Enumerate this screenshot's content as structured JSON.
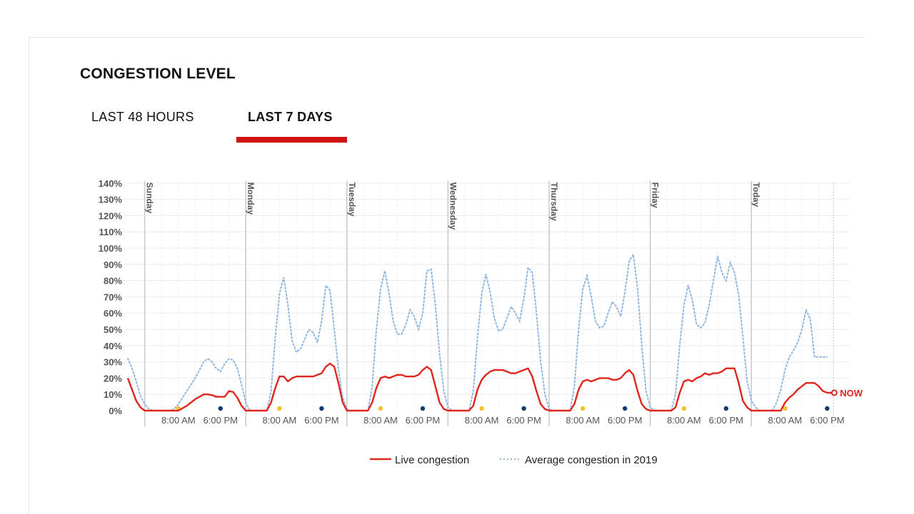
{
  "header": {
    "title": "CONGESTION LEVEL"
  },
  "tabs": [
    {
      "label": "LAST 48 HOURS",
      "active": false
    },
    {
      "label": "LAST 7 DAYS",
      "active": true
    }
  ],
  "colors": {
    "accent": "#d0120c",
    "live": "#e0261c",
    "average": "#8fb7e0",
    "grid": "#ececec",
    "day_line": "#c8c8c8",
    "morning_dot": "#f2c12e",
    "evening_dot": "#0f3c6e",
    "axis_text": "#555555"
  },
  "chart_data": {
    "type": "line",
    "y_ticks": [
      "0%",
      "10%",
      "20%",
      "30%",
      "40%",
      "50%",
      "60%",
      "70%",
      "80%",
      "90%",
      "100%",
      "110%",
      "120%",
      "130%",
      "140%"
    ],
    "ylim": [
      0,
      140
    ],
    "xlim_hours": [
      -4,
      163
    ],
    "days": [
      "Sunday",
      "Monday",
      "Tuesday",
      "Wednesday",
      "Thursday",
      "Friday",
      "Today"
    ],
    "x_tick_labels": [
      "8:00 AM",
      "6:00 PM"
    ],
    "now_label": "NOW",
    "now_hour": 163.5,
    "legend": [
      {
        "name": "Live congestion",
        "style": "solid"
      },
      {
        "name": "Average congestion in 2019",
        "style": "dotted"
      }
    ],
    "series": [
      {
        "name": "Live congestion",
        "points": [
          [
            -4,
            20
          ],
          [
            -3,
            13
          ],
          [
            -2,
            6
          ],
          [
            -1,
            2
          ],
          [
            0,
            0
          ],
          [
            5,
            0
          ],
          [
            8,
            0
          ],
          [
            10,
            3
          ],
          [
            12,
            7
          ],
          [
            14,
            10
          ],
          [
            15,
            10
          ],
          [
            16,
            9.5
          ],
          [
            17,
            8.5
          ],
          [
            19,
            8.5
          ],
          [
            20,
            12
          ],
          [
            21,
            11.5
          ],
          [
            22,
            8
          ],
          [
            23,
            3
          ],
          [
            24,
            0
          ],
          [
            29,
            0
          ],
          [
            30,
            5
          ],
          [
            31,
            14
          ],
          [
            32,
            21
          ],
          [
            33,
            21
          ],
          [
            34,
            18
          ],
          [
            35,
            20
          ],
          [
            36,
            21
          ],
          [
            40,
            21
          ],
          [
            41,
            22
          ],
          [
            42,
            23
          ],
          [
            43,
            27
          ],
          [
            44,
            29
          ],
          [
            45,
            27
          ],
          [
            46,
            17
          ],
          [
            47,
            5
          ],
          [
            48,
            0
          ],
          [
            53,
            0
          ],
          [
            54,
            5
          ],
          [
            55,
            14
          ],
          [
            56,
            20
          ],
          [
            57,
            21
          ],
          [
            58,
            20
          ],
          [
            60,
            22
          ],
          [
            61,
            22
          ],
          [
            62,
            21
          ],
          [
            64,
            21
          ],
          [
            65,
            22
          ],
          [
            66,
            25
          ],
          [
            67,
            27
          ],
          [
            68,
            25
          ],
          [
            69,
            15
          ],
          [
            70,
            5
          ],
          [
            71,
            1
          ],
          [
            72,
            0
          ],
          [
            77,
            0
          ],
          [
            78,
            3
          ],
          [
            79,
            13
          ],
          [
            80,
            19
          ],
          [
            81,
            22
          ],
          [
            82,
            24
          ],
          [
            83,
            25
          ],
          [
            85,
            25
          ],
          [
            86,
            24
          ],
          [
            87,
            23
          ],
          [
            88,
            23
          ],
          [
            89,
            24
          ],
          [
            90,
            25
          ],
          [
            91,
            26
          ],
          [
            92,
            21
          ],
          [
            93,
            12
          ],
          [
            94,
            4
          ],
          [
            95,
            1
          ],
          [
            96,
            0
          ],
          [
            101,
            0
          ],
          [
            102,
            4
          ],
          [
            103,
            13
          ],
          [
            104,
            18
          ],
          [
            105,
            19
          ],
          [
            106,
            18
          ],
          [
            107,
            19
          ],
          [
            108,
            20
          ],
          [
            110,
            20
          ],
          [
            111,
            19
          ],
          [
            112,
            19
          ],
          [
            113,
            20
          ],
          [
            114,
            23
          ],
          [
            115,
            25
          ],
          [
            116,
            22
          ],
          [
            117,
            12
          ],
          [
            118,
            4
          ],
          [
            119,
            1
          ],
          [
            120,
            0
          ],
          [
            125,
            0
          ],
          [
            126,
            2
          ],
          [
            127,
            11
          ],
          [
            128,
            18
          ],
          [
            129,
            19
          ],
          [
            130,
            18
          ],
          [
            131,
            20
          ],
          [
            132,
            21
          ],
          [
            133,
            23
          ],
          [
            134,
            22
          ],
          [
            135,
            23
          ],
          [
            136,
            23
          ],
          [
            137,
            24
          ],
          [
            138,
            26
          ],
          [
            139,
            26
          ],
          [
            140,
            26
          ],
          [
            141,
            17
          ],
          [
            142,
            6
          ],
          [
            143,
            2
          ],
          [
            144,
            0
          ],
          [
            151,
            0
          ],
          [
            152,
            5
          ],
          [
            153,
            8
          ],
          [
            154,
            10
          ],
          [
            155,
            13
          ],
          [
            156,
            15
          ],
          [
            157,
            17
          ],
          [
            159,
            17
          ],
          [
            160,
            15
          ],
          [
            161,
            12
          ],
          [
            162,
            11
          ],
          [
            163,
            11
          ]
        ]
      },
      {
        "name": "Average congestion in 2019",
        "points": [
          [
            -4,
            32
          ],
          [
            -3,
            26
          ],
          [
            -2,
            18
          ],
          [
            -1,
            9
          ],
          [
            0,
            4
          ],
          [
            1,
            1
          ],
          [
            2,
            0
          ],
          [
            6,
            0
          ],
          [
            7,
            1
          ],
          [
            8,
            4
          ],
          [
            10,
            12
          ],
          [
            12,
            20
          ],
          [
            13,
            25
          ],
          [
            14,
            30
          ],
          [
            15,
            32
          ],
          [
            16,
            30
          ],
          [
            17,
            26
          ],
          [
            18,
            24
          ],
          [
            19,
            29
          ],
          [
            20,
            32
          ],
          [
            21,
            31
          ],
          [
            22,
            26
          ],
          [
            23,
            16
          ],
          [
            24,
            5
          ],
          [
            25,
            0
          ],
          [
            29,
            0
          ],
          [
            30,
            12
          ],
          [
            31,
            45
          ],
          [
            32,
            72
          ],
          [
            33,
            82
          ],
          [
            34,
            65
          ],
          [
            35,
            43
          ],
          [
            36,
            36
          ],
          [
            37,
            38
          ],
          [
            38,
            44
          ],
          [
            39,
            50
          ],
          [
            40,
            48
          ],
          [
            41,
            42
          ],
          [
            42,
            55
          ],
          [
            43,
            77
          ],
          [
            44,
            74
          ],
          [
            45,
            50
          ],
          [
            46,
            25
          ],
          [
            47,
            8
          ],
          [
            48,
            1
          ],
          [
            49,
            0
          ],
          [
            53,
            0
          ],
          [
            54,
            15
          ],
          [
            55,
            50
          ],
          [
            56,
            75
          ],
          [
            57,
            86
          ],
          [
            58,
            72
          ],
          [
            59,
            55
          ],
          [
            60,
            47
          ],
          [
            61,
            47
          ],
          [
            62,
            53
          ],
          [
            63,
            62
          ],
          [
            64,
            58
          ],
          [
            65,
            50
          ],
          [
            66,
            60
          ],
          [
            67,
            86
          ],
          [
            68,
            87
          ],
          [
            69,
            65
          ],
          [
            70,
            35
          ],
          [
            71,
            12
          ],
          [
            72,
            2
          ],
          [
            73,
            0
          ],
          [
            77,
            0
          ],
          [
            78,
            12
          ],
          [
            79,
            45
          ],
          [
            80,
            72
          ],
          [
            81,
            84
          ],
          [
            82,
            73
          ],
          [
            83,
            57
          ],
          [
            84,
            49
          ],
          [
            85,
            50
          ],
          [
            86,
            57
          ],
          [
            87,
            64
          ],
          [
            88,
            60
          ],
          [
            89,
            55
          ],
          [
            90,
            69
          ],
          [
            91,
            88
          ],
          [
            92,
            85
          ],
          [
            93,
            60
          ],
          [
            94,
            30
          ],
          [
            95,
            10
          ],
          [
            96,
            1
          ],
          [
            97,
            0
          ],
          [
            101,
            0
          ],
          [
            102,
            15
          ],
          [
            103,
            50
          ],
          [
            104,
            75
          ],
          [
            105,
            83
          ],
          [
            106,
            70
          ],
          [
            107,
            55
          ],
          [
            108,
            51
          ],
          [
            109,
            52
          ],
          [
            110,
            60
          ],
          [
            111,
            67
          ],
          [
            112,
            64
          ],
          [
            113,
            58
          ],
          [
            114,
            73
          ],
          [
            115,
            92
          ],
          [
            116,
            96
          ],
          [
            117,
            75
          ],
          [
            118,
            40
          ],
          [
            119,
            12
          ],
          [
            120,
            2
          ],
          [
            121,
            0
          ],
          [
            125,
            0
          ],
          [
            126,
            10
          ],
          [
            127,
            40
          ],
          [
            128,
            65
          ],
          [
            129,
            77
          ],
          [
            130,
            68
          ],
          [
            131,
            53
          ],
          [
            132,
            51
          ],
          [
            133,
            54
          ],
          [
            134,
            65
          ],
          [
            135,
            80
          ],
          [
            136,
            95
          ],
          [
            137,
            85
          ],
          [
            138,
            80
          ],
          [
            139,
            91
          ],
          [
            140,
            85
          ],
          [
            141,
            71
          ],
          [
            142,
            45
          ],
          [
            143,
            18
          ],
          [
            144,
            6
          ],
          [
            145,
            2
          ],
          [
            146,
            0
          ],
          [
            149,
            0
          ],
          [
            150,
            5
          ],
          [
            151,
            13
          ],
          [
            152,
            25
          ],
          [
            153,
            33
          ],
          [
            154,
            37
          ],
          [
            155,
            42
          ],
          [
            156,
            50
          ],
          [
            157,
            62
          ],
          [
            158,
            56
          ],
          [
            159,
            33
          ],
          [
            161,
            33
          ],
          [
            162,
            33
          ]
        ]
      }
    ]
  }
}
